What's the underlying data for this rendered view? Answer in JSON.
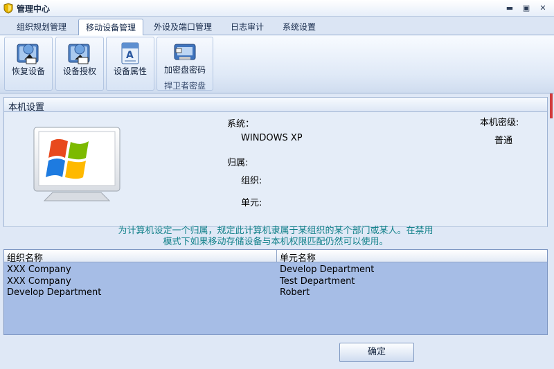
{
  "window": {
    "title": "管理中心",
    "icon": "shield-icon",
    "controls": [
      "minimize-icon",
      "maximize-icon",
      "close-icon"
    ],
    "minimize_glyph": "▬",
    "maximize_glyph": "▣",
    "close_glyph": "✕"
  },
  "tabs": [
    {
      "label": "组织规划管理",
      "active": false
    },
    {
      "label": "移动设备管理",
      "active": true
    },
    {
      "label": "外设及端口管理",
      "active": false
    },
    {
      "label": "日志审计",
      "active": false
    },
    {
      "label": "系统设置",
      "active": false
    }
  ],
  "ribbon": {
    "buttons": [
      {
        "label": "恢复设备",
        "icon": "restore-device-icon"
      },
      {
        "label": "设备授权",
        "icon": "authorize-device-icon"
      },
      {
        "label": "设备属性",
        "icon": "device-properties-icon"
      },
      {
        "label": "加密盘密码",
        "icon": "encrypted-disk-password-icon"
      }
    ],
    "group_label": "捍卫者密盘"
  },
  "section": {
    "title": "本机设置"
  },
  "machine": {
    "system_label": "系统：",
    "system_value": "WINDOWS XP",
    "belong_label": "归属:",
    "org_label": "组织:",
    "unit_label": "单元:",
    "security_level_label": "本机密级:",
    "security_level_value": "普通",
    "logo_icon": "windows-monitor-icon"
  },
  "hint": {
    "line1": "为计算机设定一个归属，规定此计算机隶属于某组织的某个部门或某人。在禁用",
    "line2": "模式下如果移动存储设备与本机权限匹配仍然可以使用。"
  },
  "table": {
    "columns": [
      "组织名称",
      "单元名称"
    ],
    "rows": [
      [
        "XXX Company",
        "Develop Department"
      ],
      [
        "XXX Company",
        "Test Department"
      ],
      [
        "Develop Department",
        "Robert"
      ]
    ]
  },
  "ok_button": {
    "label": "确定"
  },
  "colors": {
    "table_bg": "#a6bde6",
    "hint_text": "#12818a",
    "accent_blue": "#8fa9cf"
  }
}
